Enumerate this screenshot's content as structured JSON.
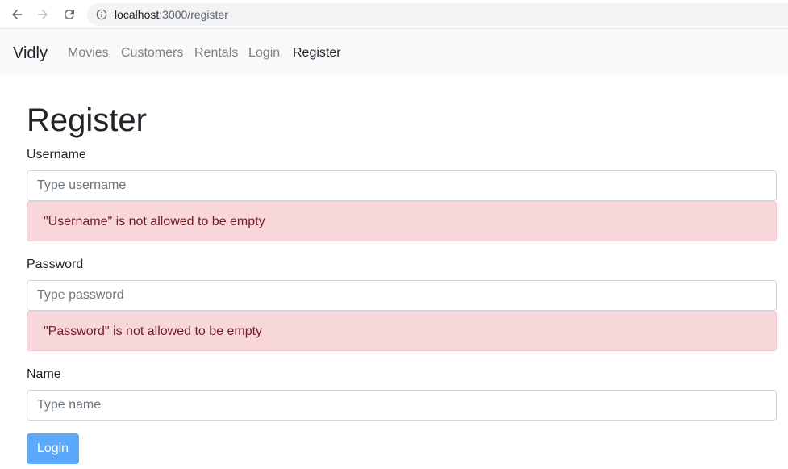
{
  "browser": {
    "url_host": "localhost",
    "url_path": ":3000/register",
    "icons": [
      "back-icon",
      "forward-icon",
      "reload-icon",
      "info-icon"
    ]
  },
  "navbar": {
    "brand": "Vidly",
    "links": [
      {
        "label": "Movies",
        "active": false
      },
      {
        "label": "Customers",
        "active": false
      },
      {
        "label": "Rentals",
        "active": false
      },
      {
        "label": "Login",
        "active": false
      },
      {
        "label": "Register",
        "active": true
      }
    ]
  },
  "page": {
    "title": "Register"
  },
  "form": {
    "username": {
      "label": "Username",
      "placeholder": "Type username",
      "value": "",
      "error": "\"Username\" is not allowed to be empty"
    },
    "password": {
      "label": "Password",
      "placeholder": "Type password",
      "value": "",
      "error": "\"Password\" is not allowed to be empty"
    },
    "name": {
      "label": "Name",
      "placeholder": "Type name",
      "value": ""
    },
    "submit_label": "Login",
    "submit_disabled": true
  },
  "colors": {
    "primary_disabled": "#5aa9fb",
    "alert_bg": "#f8d7da",
    "alert_text": "#721c24",
    "navbar_bg": "#f8f9fa"
  }
}
